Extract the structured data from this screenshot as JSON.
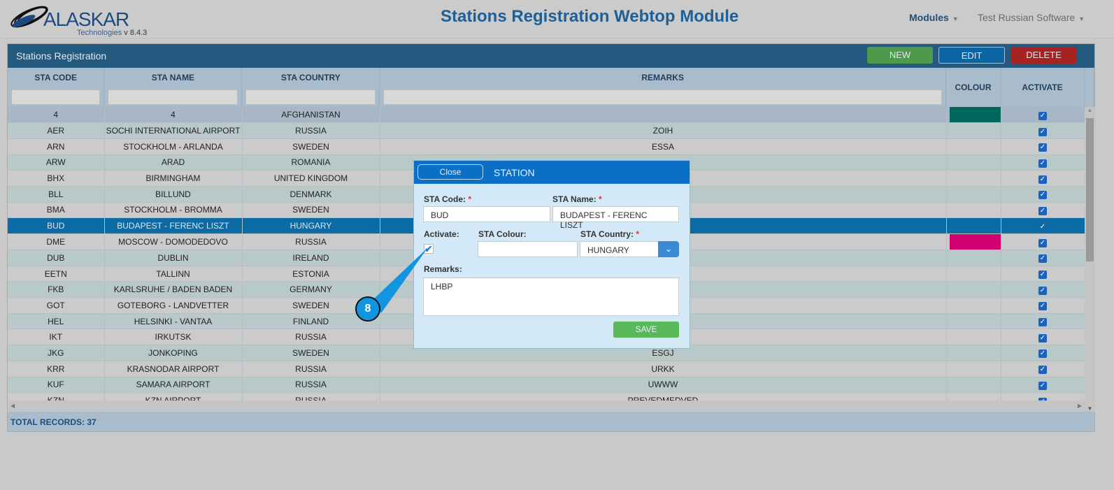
{
  "header": {
    "logo_word": "ALASKAR",
    "logo_sub": "Technologies",
    "version": "v 8.4.3",
    "title": "Stations Registration Webtop Module",
    "modules": "Modules",
    "user": "Test Russian Software"
  },
  "panel": {
    "title": "Stations Registration",
    "new": "NEW",
    "edit": "EDIT",
    "delete": "DELETE"
  },
  "columns": [
    "STA CODE",
    "STA NAME",
    "STA COUNTRY",
    "REMARKS",
    "COLOUR",
    "ACTIVATE"
  ],
  "rows": [
    {
      "code": "4",
      "name": "4",
      "country": "AFGHANISTAN",
      "remarks": "",
      "colour": "#00675e",
      "active": true
    },
    {
      "code": "AER",
      "name": "SOCHI INTERNATIONAL AIRPORT",
      "country": "RUSSIA",
      "remarks": "ZOIH",
      "colour": "",
      "active": true
    },
    {
      "code": "ARN",
      "name": "STOCKHOLM - ARLANDA",
      "country": "SWEDEN",
      "remarks": "ESSA",
      "colour": "",
      "active": true
    },
    {
      "code": "ARW",
      "name": "ARAD",
      "country": "ROMANIA",
      "remarks": "",
      "colour": "",
      "active": true
    },
    {
      "code": "BHX",
      "name": "BIRMINGHAM",
      "country": "UNITED KINGDOM",
      "remarks": "",
      "colour": "",
      "active": true
    },
    {
      "code": "BLL",
      "name": "BILLUND",
      "country": "DENMARK",
      "remarks": "",
      "colour": "",
      "active": true
    },
    {
      "code": "BMA",
      "name": "STOCKHOLM - BROMMA",
      "country": "SWEDEN",
      "remarks": "",
      "colour": "",
      "active": true
    },
    {
      "code": "BUD",
      "name": "BUDAPEST - FERENC LISZT",
      "country": "HUNGARY",
      "remarks": "",
      "colour": "",
      "active": true
    },
    {
      "code": "DME",
      "name": "MOSCOW - DOMODEDOVO",
      "country": "RUSSIA",
      "remarks": "",
      "colour": "#d0006f",
      "active": true
    },
    {
      "code": "DUB",
      "name": "DUBLIN",
      "country": "IRELAND",
      "remarks": "",
      "colour": "",
      "active": true
    },
    {
      "code": "EETN",
      "name": "TALLINN",
      "country": "ESTONIA",
      "remarks": "",
      "colour": "",
      "active": true
    },
    {
      "code": "FKB",
      "name": "KARLSRUHE / BADEN BADEN",
      "country": "GERMANY",
      "remarks": "",
      "colour": "",
      "active": true
    },
    {
      "code": "GOT",
      "name": "GOTEBORG - LANDVETTER",
      "country": "SWEDEN",
      "remarks": "",
      "colour": "",
      "active": true
    },
    {
      "code": "HEL",
      "name": "HELSINKI - VANTAA",
      "country": "FINLAND",
      "remarks": "",
      "colour": "",
      "active": true
    },
    {
      "code": "IKT",
      "name": "IRKUTSK",
      "country": "RUSSIA",
      "remarks": "",
      "colour": "",
      "active": true
    },
    {
      "code": "JKG",
      "name": "JONKOPING",
      "country": "SWEDEN",
      "remarks": "ESGJ",
      "colour": "",
      "active": true
    },
    {
      "code": "KRR",
      "name": "KRASNODAR AIRPORT",
      "country": "RUSSIA",
      "remarks": "URKK",
      "colour": "",
      "active": true
    },
    {
      "code": "KUF",
      "name": "SAMARA AIRPORT",
      "country": "RUSSIA",
      "remarks": "UWWW",
      "colour": "",
      "active": true
    },
    {
      "code": "KZN",
      "name": "KZN AIRPORT",
      "country": "RUSSIA",
      "remarks": "PREVEDMEDVED",
      "colour": "",
      "active": true
    }
  ],
  "footer": {
    "total": "TOTAL RECORDS: 37"
  },
  "modal": {
    "close": "Close",
    "title": "STATION",
    "code_label": "STA Code:",
    "code": "BUD",
    "name_label": "STA Name:",
    "name": "BUDAPEST - FERENC LISZT",
    "activate_label": "Activate:",
    "activate": true,
    "colour_label": "STA Colour:",
    "colour": "",
    "country_label": "STA Country:",
    "country": "HUNGARY",
    "remarks_label": "Remarks:",
    "remarks": "LHBP",
    "save": "SAVE",
    "required": "*"
  },
  "callout": {
    "number": "8",
    "color": "#1195e0"
  }
}
